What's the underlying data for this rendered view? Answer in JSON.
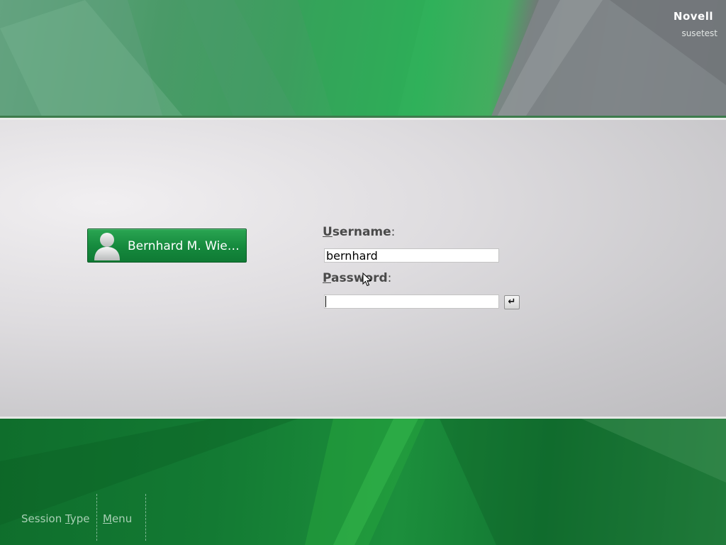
{
  "branding": {
    "brand_name": "Novell",
    "hostname": "susetest"
  },
  "user_list": {
    "selected_user": "Bernhard M. Wie…"
  },
  "login_form": {
    "username_label_accel": "U",
    "username_label_rest": "sername",
    "username_value": "bernhard",
    "password_label_accel": "P",
    "password_label_rest": "assword",
    "label_colon": ":",
    "password_value": "",
    "enter_button_glyph": "↵"
  },
  "bottom_bar": {
    "session_type_pre": "Session ",
    "session_type_accel": "T",
    "session_type_post": "ype",
    "menu_accel": "M",
    "menu_post": "enu"
  },
  "colors": {
    "accent_green": "#15893d",
    "panel_gray": "#d6d5d8"
  }
}
